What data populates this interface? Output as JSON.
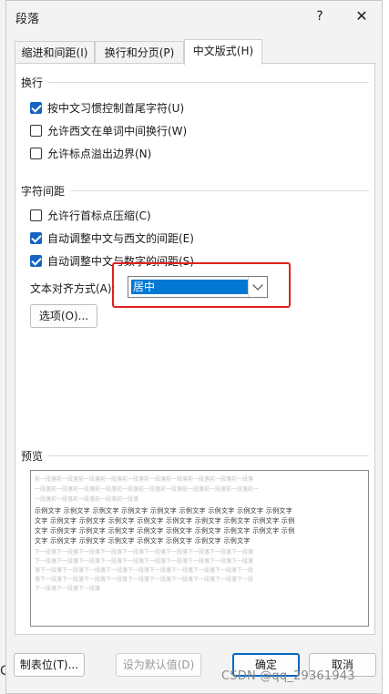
{
  "dialog": {
    "title": "段落",
    "help": "?",
    "close": "✕"
  },
  "tabs": [
    {
      "label": "缩进和间距(I)",
      "active": false
    },
    {
      "label": "换行和分页(P)",
      "active": false
    },
    {
      "label": "中文版式(H)",
      "active": true
    }
  ],
  "line_break_group": {
    "title": "换行",
    "options": [
      {
        "label": "按中文习惯控制首尾字符(U)",
        "checked": true
      },
      {
        "label": "允许西文在单词中间换行(W)",
        "checked": false
      },
      {
        "label": "允许标点溢出边界(N)",
        "checked": false
      }
    ]
  },
  "spacing_group": {
    "title": "字符间距",
    "options": [
      {
        "label": "允许行首标点压缩(C)",
        "checked": false
      },
      {
        "label": "自动调整中文与西文的间距(E)",
        "checked": true
      },
      {
        "label": "自动调整中文与数字的间距(S)",
        "checked": true
      }
    ]
  },
  "alignment": {
    "label": "文本对齐方式(A):",
    "value": "居中"
  },
  "options_button": "选项(O)...",
  "preview": {
    "title": "预览",
    "prev_para": [
      "前一段落前一段落前一段落前一段落前一段落前一段落前一段落前一段落前一段落前一段落",
      "一段落前一段落前一段落前一段落前一段落前一段落前一段落前一段落前一段落前一段落前一",
      "一段落前一段落前一段落前一段落前一段落"
    ],
    "sample": [
      "示例文字 示例文字 示例文字 示例文字 示例文字 示例文字 示例文字 示例文字 示例文字",
      "文字 示例文字 示例文字 示例文字 示例文字 示例文字 示例文字 示例文字 示例文字 示例",
      "文字 示例文字 示例文字 示例文字 示例文字 示例文字 示例文字 示例文字 示例文字 示例",
      "文字 示例文字 示例文字 示例文字 示例文字 示例文字 示例文字 示例文字"
    ],
    "next_para": [
      "下一段落下一段落下一段落下一段落下一段落下一段落下一段落下一段落下一段落下一段落",
      "下一段落下一段落下一段落下一段落下一段落下一段落下一段落下一段落下一段落下一段落",
      "落下一段落下一段落下一段落下一段落下一段落下一段落下一段落下一段落下一段落下一段",
      "落下一段落下一段落下一段落下一段落下一段落下一段落下一段落下一段落下一段落下一段",
      "下一段落下一段落下一段落"
    ]
  },
  "buttons": {
    "tabs": "制表位(T)...",
    "set_default": "设为默认值(D)",
    "ok": "确定",
    "cancel": "取消"
  },
  "watermark": "CSDN @qq_29361943",
  "edge_char": "C"
}
